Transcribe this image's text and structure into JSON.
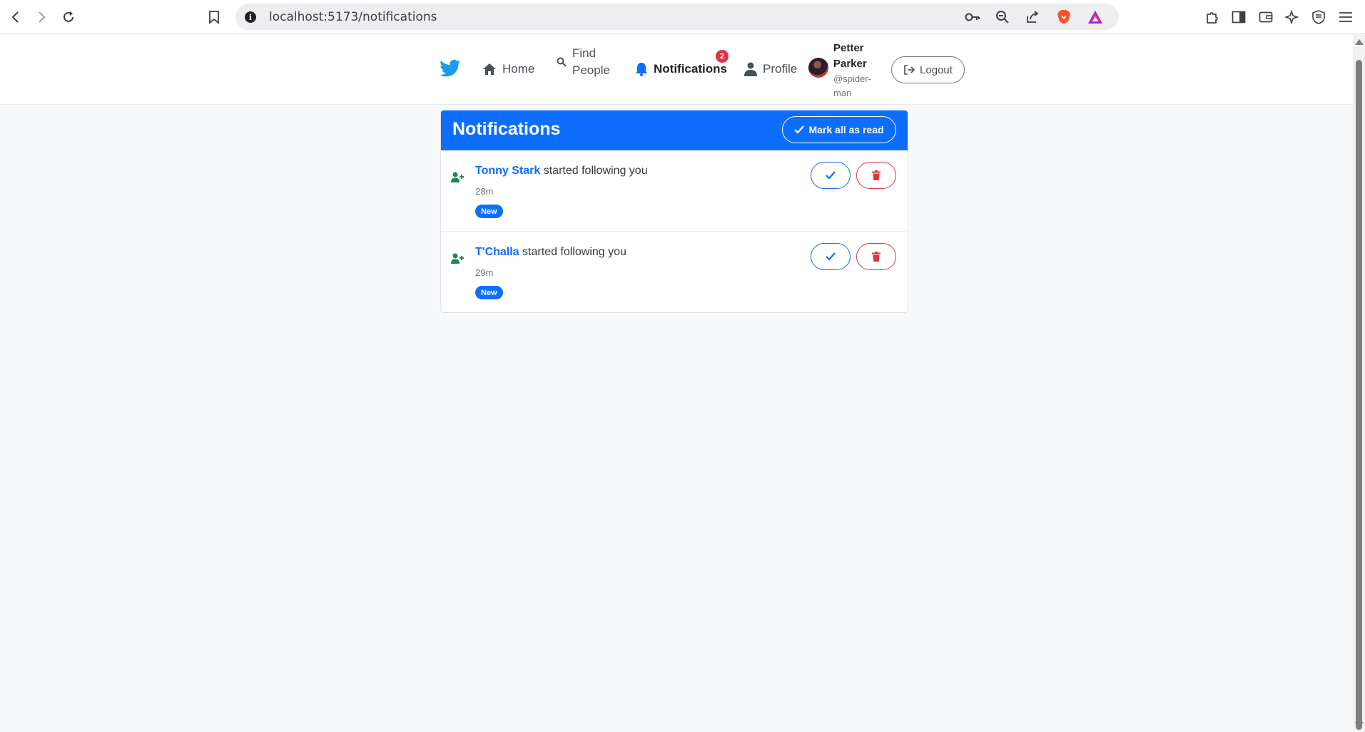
{
  "browser": {
    "url": "localhost:5173/notifications",
    "info_glyph": "i"
  },
  "nav": {
    "items": [
      {
        "label": "Home",
        "icon": "home-icon"
      },
      {
        "label": "Find\nPeople",
        "icon": "search-icon"
      },
      {
        "label": "Notifications",
        "icon": "bell-icon",
        "active": true
      },
      {
        "label": "Profile",
        "icon": "person-icon"
      }
    ],
    "notification_count": "2",
    "user": {
      "name": "Petter Parker",
      "handle": "@spider-man"
    },
    "logout_label": "Logout"
  },
  "notifications_panel": {
    "title": "Notifications",
    "mark_all_label": "Mark all as read",
    "items": [
      {
        "user": "Tonny Stark",
        "text": "started following you",
        "time": "28m",
        "badge": "New"
      },
      {
        "user": "T'Challa",
        "text": "started following you",
        "time": "29m",
        "badge": "New"
      }
    ]
  },
  "colors": {
    "primary": "#0d6efd",
    "danger": "#dc3545",
    "success": "#198754",
    "brand": "#1d9bf0"
  }
}
